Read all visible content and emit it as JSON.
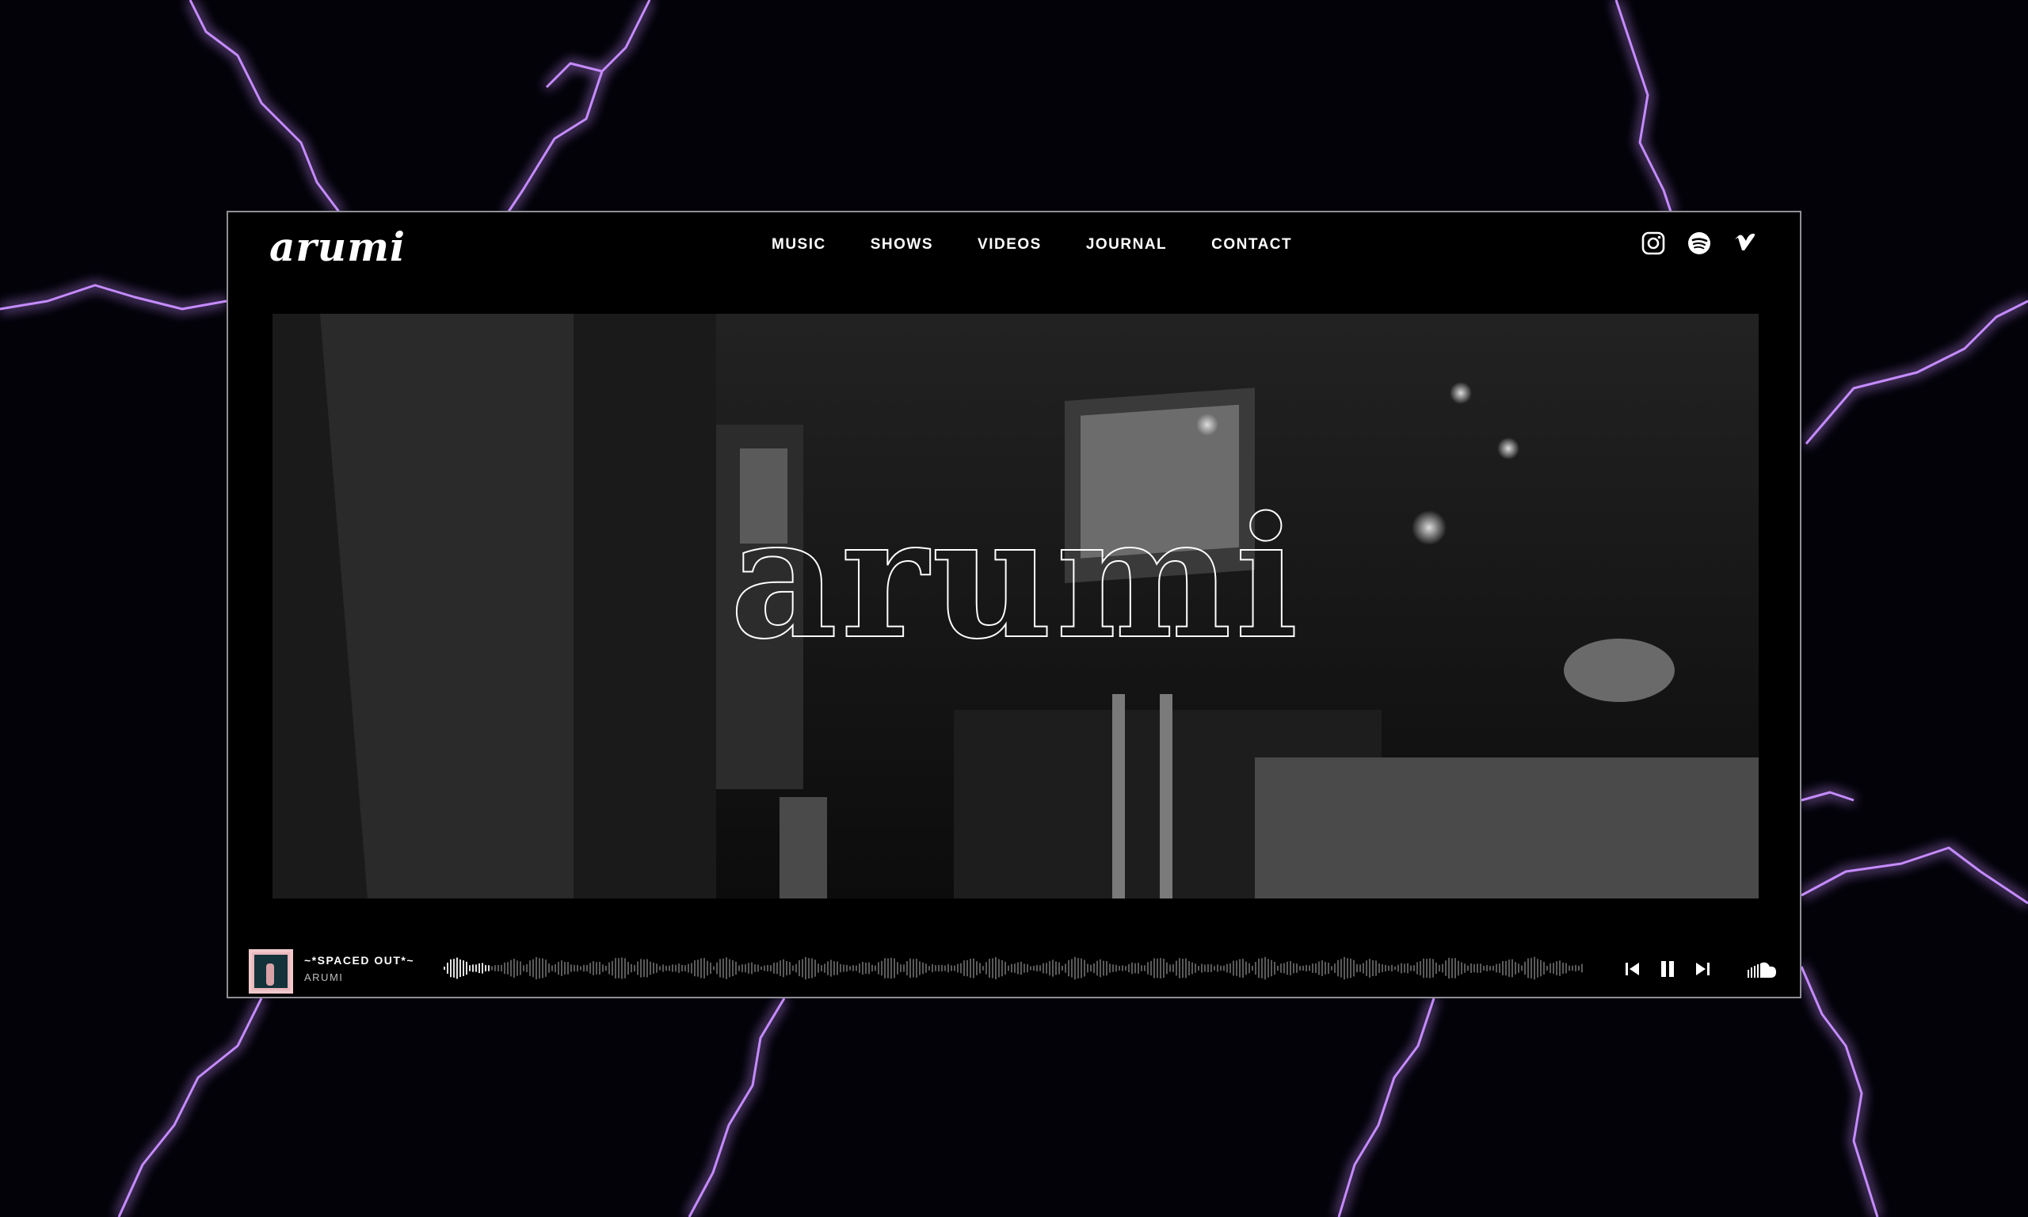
{
  "header": {
    "logo": "arumi",
    "nav": [
      "MUSIC",
      "SHOWS",
      "VIDEOS",
      "JOURNAL",
      "CONTACT"
    ],
    "socials": [
      "instagram-icon",
      "spotify-icon",
      "vimeo-icon"
    ]
  },
  "hero": {
    "title": "arumi"
  },
  "player": {
    "track_title": "~*SPACED OUT*~",
    "artist": "ARUMI",
    "progress": 0.04,
    "controls": [
      "previous-icon",
      "pause-icon",
      "next-icon"
    ],
    "source_icon": "soundcloud-icon"
  },
  "colors": {
    "lightning": "#a24bff",
    "frame_border": "#8f8f97",
    "wave_played": "#e0e0e0",
    "wave_unplayed": "#5a5a5a",
    "thumb_border": "#f0c8cc"
  }
}
